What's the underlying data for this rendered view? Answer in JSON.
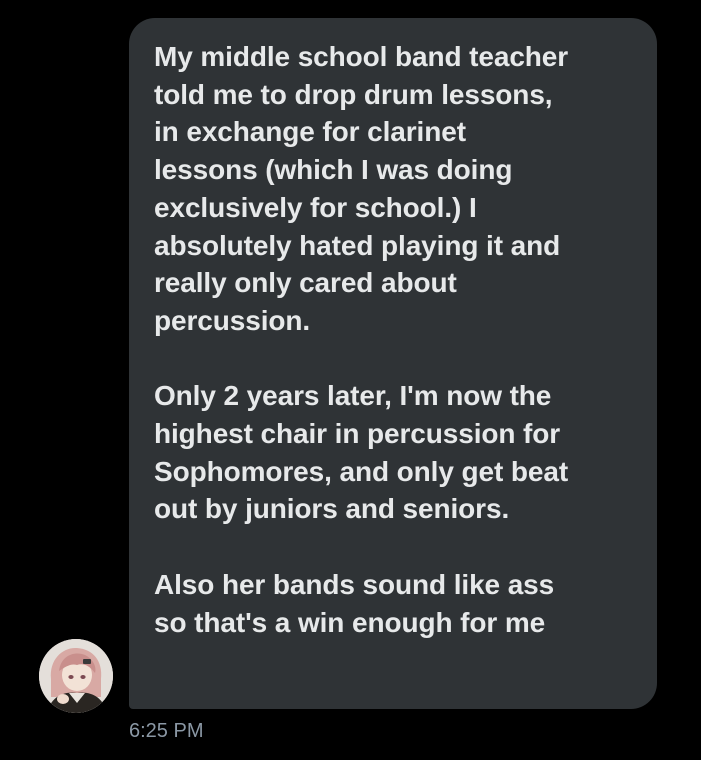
{
  "message": {
    "paragraphs": [
      {
        "lines": [
          "My middle school band teacher",
          "told me to drop drum lessons,",
          "in exchange for clarinet",
          "lessons (which I was doing",
          "exclusively for school.) I",
          "absolutely hated playing it and",
          "really only cared about",
          "percussion."
        ]
      },
      {
        "lines": [
          "Only 2 years later, I'm now the",
          "highest chair in percussion for",
          "Sophomores, and only get beat",
          "out by juniors and seniors."
        ]
      },
      {
        "lines": [
          "Also her bands sound like ass",
          "so that's a win enough for me"
        ]
      }
    ],
    "timestamp": "6:25 PM"
  },
  "avatar": {
    "icon": "user-avatar-icon"
  },
  "colors": {
    "background": "#000000",
    "bubble": "#2f3336",
    "text": "#e7e9ea",
    "timestamp": "#8b98a5"
  }
}
